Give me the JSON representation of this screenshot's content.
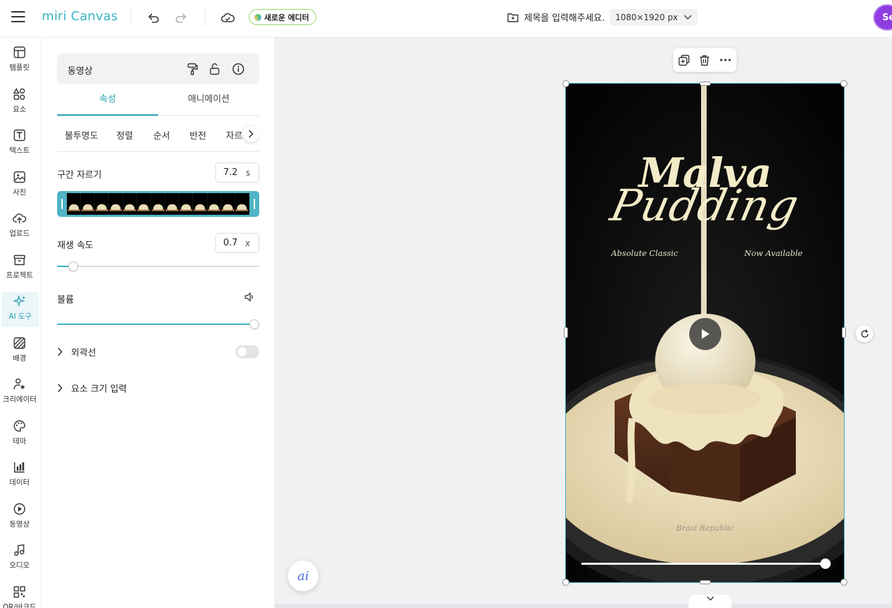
{
  "app": {
    "logo_text": "miri Canvas",
    "new_editor_label": "새로운 에디터",
    "doc_title_placeholder": "제목을 입력해주세요.",
    "canvas_size": "1080×1920 px",
    "avatar_initials": "Se"
  },
  "rail": [
    {
      "label": "템플릿",
      "icon": "template-icon"
    },
    {
      "label": "요소",
      "icon": "elements-icon"
    },
    {
      "label": "텍스트",
      "icon": "text-icon"
    },
    {
      "label": "사진",
      "icon": "photo-icon"
    },
    {
      "label": "업로드",
      "icon": "upload-icon"
    },
    {
      "label": "프로젝트",
      "icon": "project-icon"
    },
    {
      "label": "AI 도구",
      "icon": "ai-tools-icon",
      "active": true
    },
    {
      "label": "배경",
      "icon": "background-icon"
    },
    {
      "label": "크리에이터",
      "icon": "creator-icon"
    },
    {
      "label": "테마",
      "icon": "theme-icon"
    },
    {
      "label": "데이터",
      "icon": "data-icon"
    },
    {
      "label": "동영상",
      "icon": "video-icon"
    },
    {
      "label": "오디오",
      "icon": "audio-icon"
    },
    {
      "label": "QR/바코드",
      "icon": "qr-icon"
    }
  ],
  "panel": {
    "element_type": "동영상",
    "tabs": [
      "속성",
      "애니메이션"
    ],
    "subtabs": [
      "불투명도",
      "정렬",
      "순서",
      "반전",
      "자르기"
    ],
    "trim_label": "구간 자르기",
    "trim_value": "7.2",
    "trim_unit": "s",
    "speed_label": "재생 속도",
    "speed_value": "0.7",
    "speed_unit": "x",
    "speed_slider_fraction": 0.08,
    "volume_label": "볼륨",
    "volume_fraction": 1.0,
    "outline_label": "외곽선",
    "outline_enabled": false,
    "size_input_label": "요소 크기 입력"
  },
  "artboard": {
    "title_line1": "Malva",
    "title_line2": "Pudding",
    "subtitle_left": "Absolute Classic",
    "subtitle_right": "Now Available",
    "brand": "Braai Republic",
    "video_progress_fraction": 0.99
  },
  "ai_button_label": "ai",
  "colors": {
    "accent": "#3ab3c3",
    "avatar": "#8f3ce0",
    "title_cream": "#f4ecc8"
  }
}
